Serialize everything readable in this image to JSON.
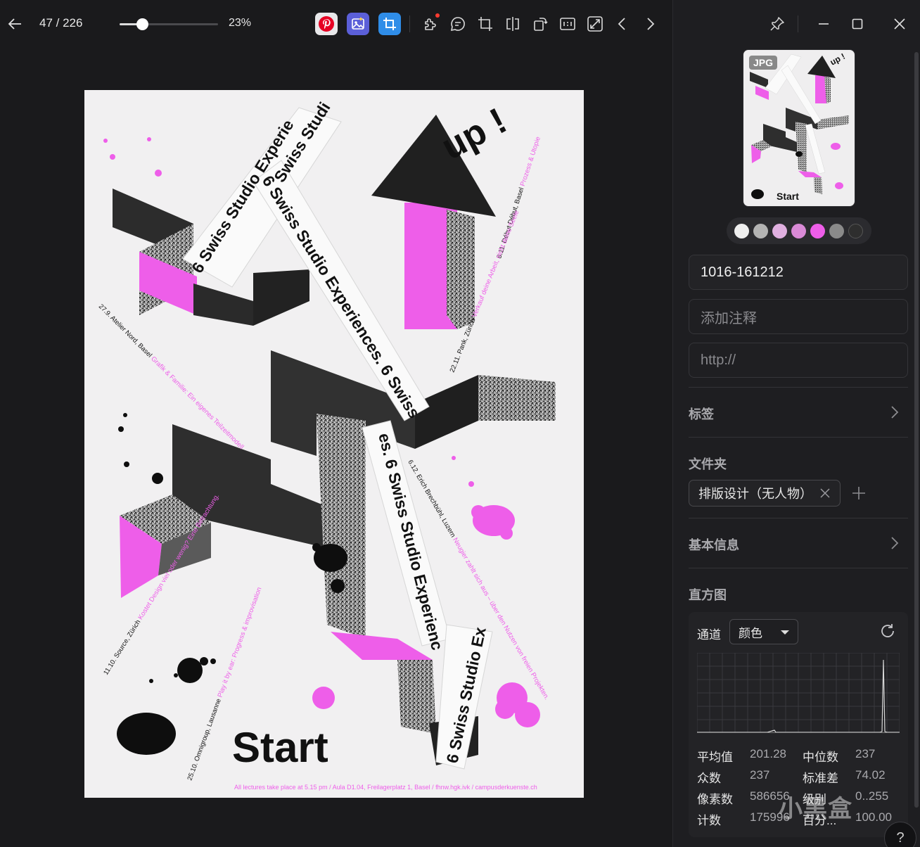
{
  "toolbar": {
    "counter": "47 / 226",
    "zoom": {
      "value": 0.23,
      "label": "23%"
    },
    "extensions": [
      {
        "name": "pinterest",
        "color": "#e8e8ea"
      },
      {
        "name": "image-tool",
        "color": "#5b5fd8"
      },
      {
        "name": "crop-tool",
        "color": "#2f8de8"
      }
    ],
    "tools": [
      "plugin-icon",
      "comment-icon",
      "crop-icon",
      "flip-icon",
      "rotate-icon",
      "actual-size-icon",
      "fit-screen-icon",
      "prev-icon",
      "next-icon"
    ]
  },
  "poster": {
    "words": {
      "up": "up !",
      "start": "Start",
      "series_1": "6 Swiss Studio Experie",
      "series_2": "Swiss Studi",
      "series_3": "6 Swiss Studio Experiences. 6 Swiss",
      "series_4": "es. 6 Swiss Studio Experienc",
      "series_5": "6 Swiss Studio Ex"
    },
    "notes": {
      "n1": "8.11. Début Début, Basel",
      "n1b": "Prozess & Utopie",
      "n2": "22.11. Pank, Zürich",
      "n2b": "Verkauf deine Arbeit, nicht deine Seele",
      "n3": "27.9. Atelier Nord, Basel",
      "n3b": "Grafik & Familie: Ein eigenes Teilzeitmodell",
      "n4": "6.12. Erich Brechbühl, Luzern",
      "n4b": "Neugier zahlt sich aus – über den Nutzen von freien Projekten.",
      "n5": "11.10. Source, Zürich",
      "n5b": "Kostet Design viel oder wenig? Eine Betrachtung.",
      "n6": "25.10. Omnigroup, Lausanne",
      "n6b": "Play it by ear: Progress & improvisation"
    },
    "footer": "All lectures take place at 5.15 pm / Aula D1.04, Freilagerplatz 1, Basel  /  fhnw.hgk.ivk / campusderkuenste.ch",
    "accent": "#ee5ee9"
  },
  "panel": {
    "thumb_badge": "JPG",
    "thumb_word": "Start",
    "thumb_up": "up !",
    "swatches": [
      "#efefef",
      "#b3b3b3",
      "#e0b0e0",
      "#d98ad6",
      "#ee5ee9",
      "#8a8a8a",
      "#2e2e2e"
    ],
    "name": "1016-161212",
    "note_placeholder": "添加注释",
    "url_placeholder": "http://",
    "sections": {
      "tags": "标签",
      "folder": "文件夹",
      "basic": "基本信息",
      "histogram": "直方图"
    },
    "folder_chip": "排版设计（无人物）",
    "histogram": {
      "channel_label": "通道",
      "channel_value": "颜色",
      "stats": [
        {
          "k": "平均值",
          "v": "201.28"
        },
        {
          "k": "中位数",
          "v": "237"
        },
        {
          "k": "众数",
          "v": "237"
        },
        {
          "k": "标准差",
          "v": "74.02"
        },
        {
          "k": "像素数",
          "v": "586656"
        },
        {
          "k": "级别",
          "v": "0..255"
        },
        {
          "k": "计数",
          "v": "175996"
        },
        {
          "k": "百分...",
          "v": "100.00"
        }
      ]
    },
    "watermark": "小黑盒",
    "help": "?"
  }
}
